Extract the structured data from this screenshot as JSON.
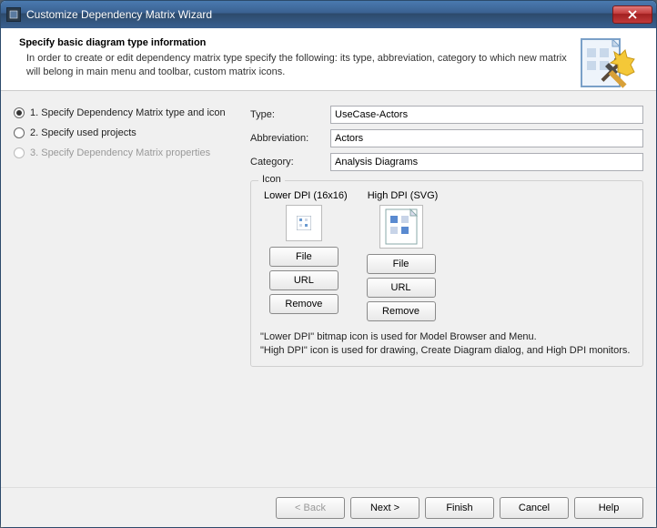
{
  "window": {
    "title": "Customize Dependency Matrix Wizard"
  },
  "header": {
    "title": "Specify basic diagram type information",
    "description": "In order to create or edit dependency matrix type specify the following: its type, abbreviation, category to which new matrix will belong in main menu and toolbar, custom matrix icons."
  },
  "steps": [
    {
      "label": "1. Specify Dependency Matrix type and icon",
      "selected": true,
      "enabled": true
    },
    {
      "label": "2. Specify used projects",
      "selected": false,
      "enabled": true
    },
    {
      "label": "3. Specify Dependency Matrix properties",
      "selected": false,
      "enabled": false
    }
  ],
  "form": {
    "type_label": "Type:",
    "type_value": "UseCase-Actors",
    "abbrev_label": "Abbreviation:",
    "abbrev_value": "Actors",
    "category_label": "Category:",
    "category_value": "Analysis Diagrams"
  },
  "icon_section": {
    "legend": "Icon",
    "lower_dpi_label": "Lower DPI (16x16)",
    "high_dpi_label": "High DPI (SVG)",
    "file_btn": "File",
    "url_btn": "URL",
    "remove_btn": "Remove",
    "hint_line1": "\"Lower DPI\" bitmap icon is used for Model Browser and Menu.",
    "hint_line2": "\"High DPI\" icon is used for drawing, Create Diagram dialog, and High DPI monitors."
  },
  "footer": {
    "back": "< Back",
    "next": "Next >",
    "finish": "Finish",
    "cancel": "Cancel",
    "help": "Help"
  }
}
